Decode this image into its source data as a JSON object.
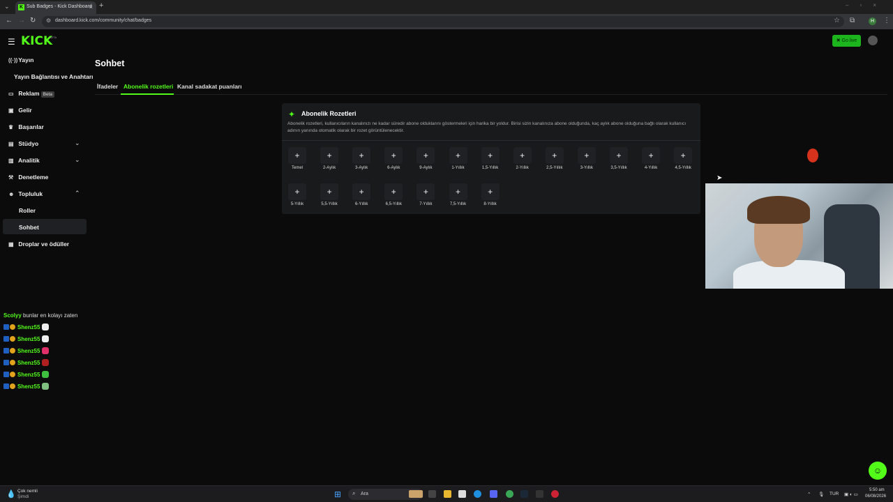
{
  "browser": {
    "tab_title": "Sub Badges - Kick Dashboard",
    "url": "dashboard.kick.com/community/chat/badges",
    "profile_initial": "H"
  },
  "header": {
    "logo": "KICK",
    "logo_beta": "BETA",
    "go_live_label": "Go live"
  },
  "sidebar": {
    "items": [
      {
        "label": "Yayın",
        "icon": "broadcast-icon"
      },
      {
        "label": "Yayın Bağlantısı ve Anahtarı",
        "icon": ""
      },
      {
        "label": "Reklam",
        "icon": "ad-icon",
        "badge": "Beta"
      },
      {
        "label": "Gelir",
        "icon": "wallet-icon"
      },
      {
        "label": "Başarılar",
        "icon": "trophy-icon"
      },
      {
        "label": "Stüdyo",
        "icon": "studio-icon"
      },
      {
        "label": "Analitik",
        "icon": "chart-icon"
      },
      {
        "label": "Denetleme",
        "icon": "hammer-icon"
      },
      {
        "label": "Topluluk",
        "icon": "community-icon"
      },
      {
        "label": "Roller",
        "icon": ""
      },
      {
        "label": "Sohbet",
        "icon": ""
      },
      {
        "label": "Droplar ve ödüller",
        "icon": "gift-icon"
      }
    ]
  },
  "main": {
    "title": "Sohbet",
    "tabs": [
      {
        "label": "İfadeler",
        "active": false
      },
      {
        "label": "Abonelik rozetleri",
        "active": true
      },
      {
        "label": "Kanal sadakat puanları",
        "active": false
      }
    ],
    "card": {
      "title": "Abonelik Rozetleri",
      "description": "Abonelik rozetleri, kullanıcıların kanalınızı ne kadar süredir abone olduklarını göstermeleri için harika bir yoldur. Birisi sizin kanalınıza abone olduğunda, kaç aylık abone olduğuna bağlı olarak kullanıcı adının yanında otomatik olarak bir rozet görüntülenecektir.",
      "badges_row1": [
        "Temel",
        "2-Aylık",
        "3-Aylık",
        "6-Aylık",
        "9-Aylık",
        "1-Yıllık",
        "1,5-Yıllık",
        "2-Yıllık",
        "2,5-Yıllık",
        "3-Yıllık",
        "3,5-Yıllık",
        "4-Yıllık",
        "4,5-Yıllık"
      ],
      "badges_row2": [
        "5-Yıllık",
        "5,5-Yıllık",
        "6-Yıllık",
        "6,5-Yıllık",
        "7-Yıllık",
        "7,5-Yıllık",
        "8-Yıllık"
      ],
      "add_symbol": "+"
    }
  },
  "chat_overlay": {
    "header_user": "Scolyy",
    "header_message": "bunlar en kolayı zaten",
    "rows": [
      {
        "user": "Shenz55",
        "emote_color": "#eeeeee"
      },
      {
        "user": "Shenz55",
        "emote_color": "#eeeeee"
      },
      {
        "user": "Shenz55",
        "emote_color": "#e0306a"
      },
      {
        "user": "Shenz55",
        "emote_color": "#b02020"
      },
      {
        "user": "Shenz55",
        "emote_color": "#3fbf3f"
      },
      {
        "user": "Shenz55",
        "emote_color": "#7fbf7f"
      }
    ]
  },
  "taskbar": {
    "weather_line1": "Çok nemli",
    "weather_line2": "Şimdi",
    "search_placeholder": "Ara",
    "language": "TUR",
    "time": "5:50 am",
    "date": "06/08/2026"
  },
  "colors": {
    "accent": "#53fc18",
    "background": "#0b0b0c",
    "card": "#181a1c"
  }
}
